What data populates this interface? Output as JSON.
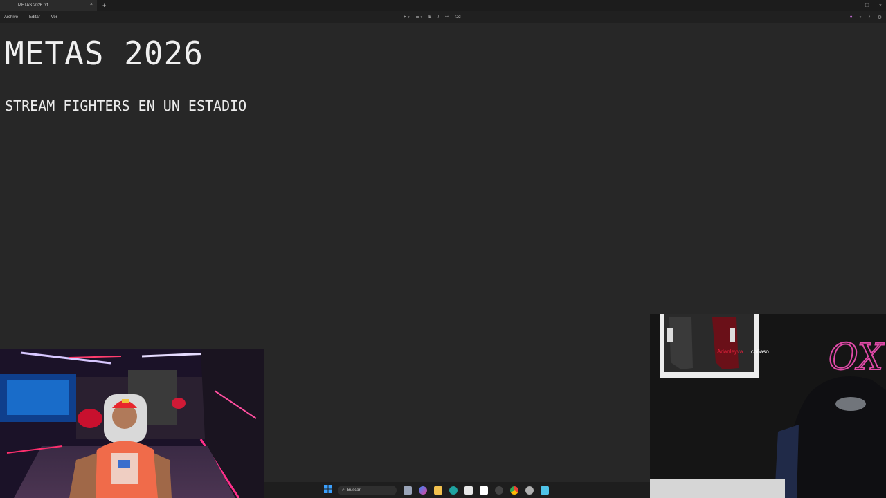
{
  "titlebar": {
    "tab_title": "METAS 2026.txt",
    "close_glyph": "×",
    "new_tab_glyph": "+",
    "window_controls": [
      "–",
      "❐",
      "×"
    ]
  },
  "menubar": {
    "items": [
      "Archivo",
      "Editar",
      "Ver"
    ],
    "heading_tool": "H",
    "list_tool": "☰",
    "bold_tool": "B",
    "italic_tool": "I"
  },
  "document": {
    "title": "METAS 2026",
    "lines": [
      "STREAM FIGHTERS EN UN ESTADIO"
    ]
  },
  "overlay": {
    "chat_user": "Adanleyva",
    "chat_message": "coñaso",
    "neon_sign": "OX"
  },
  "taskbar": {
    "search_placeholder": "Buscar"
  },
  "colors": {
    "editor_bg": "#272727",
    "titlebar_bg": "#1c1c1c",
    "menubar_bg": "#202020",
    "text": "#f0f0f0",
    "neon_pink": "#e04aa8",
    "chat_user_red": "#e0203a"
  }
}
